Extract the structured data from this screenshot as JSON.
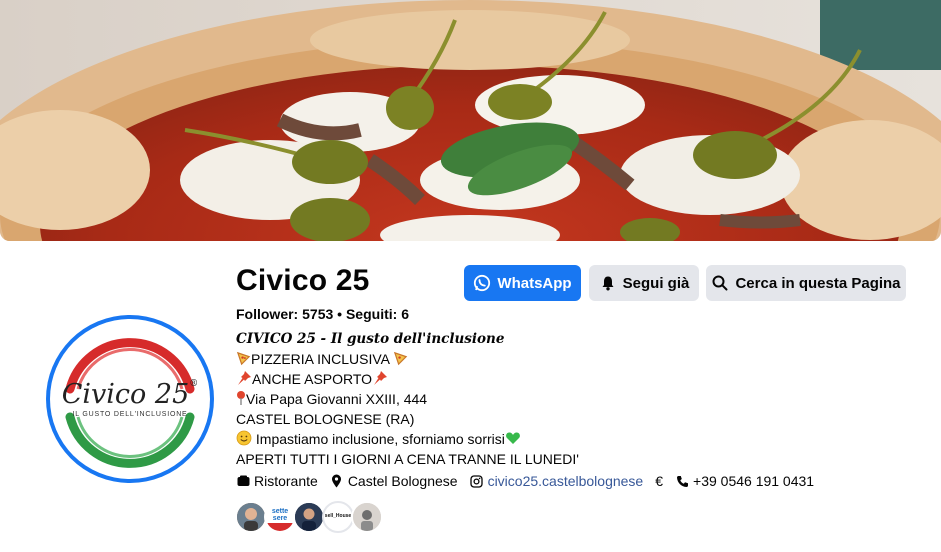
{
  "page": {
    "name": "Civico 25",
    "followers_label": "Follower:",
    "followers_count": "5753",
    "following_label": "Seguiti:",
    "following_count": "6",
    "separator": "•"
  },
  "avatar": {
    "logo_text": "Civico 25",
    "logo_mark": "®",
    "logo_subtitle": "IL GUSTO DELL'INCLUSIONE",
    "colors": {
      "red": "#d62b2b",
      "green": "#2f9a46",
      "ring": "#1877f2"
    }
  },
  "actions": {
    "whatsapp_label": "WhatsApp",
    "follow_label": "Segui già",
    "search_label": "Cerca in questa Pagina"
  },
  "bio": {
    "tagline": "CIVICO 25 - Il gusto dell'inclusione",
    "line1": "PIZZERIA INCLUSIVA",
    "line2": "ANCHE ASPORTO",
    "line3": "Via Papa Giovanni XXIII, 444",
    "line4": "CASTEL BOLOGNESE (RA)",
    "line5": "Impastiamo inclusione, sforniamo sorrisi",
    "line6": "APERTI TUTTI I GIORNI A CENA TRANNE IL LUNEDI'"
  },
  "info": {
    "category": "Ristorante",
    "location": "Castel Bolognese",
    "instagram": "civico25.castelbolognese",
    "price": "€",
    "phone": "+39 0546 191 0431"
  },
  "friends": {
    "badge_1": "sette sere",
    "badge_2": "sell_House"
  },
  "icons": {
    "whatsapp": "whatsapp-icon",
    "follow": "bell-icon",
    "search": "search-icon",
    "category": "tag-icon",
    "location": "location-pin-icon",
    "instagram": "instagram-icon",
    "phone": "phone-icon"
  },
  "colors": {
    "primary": "#1877f2",
    "button_grey": "#e4e6eb",
    "link": "#385898"
  }
}
